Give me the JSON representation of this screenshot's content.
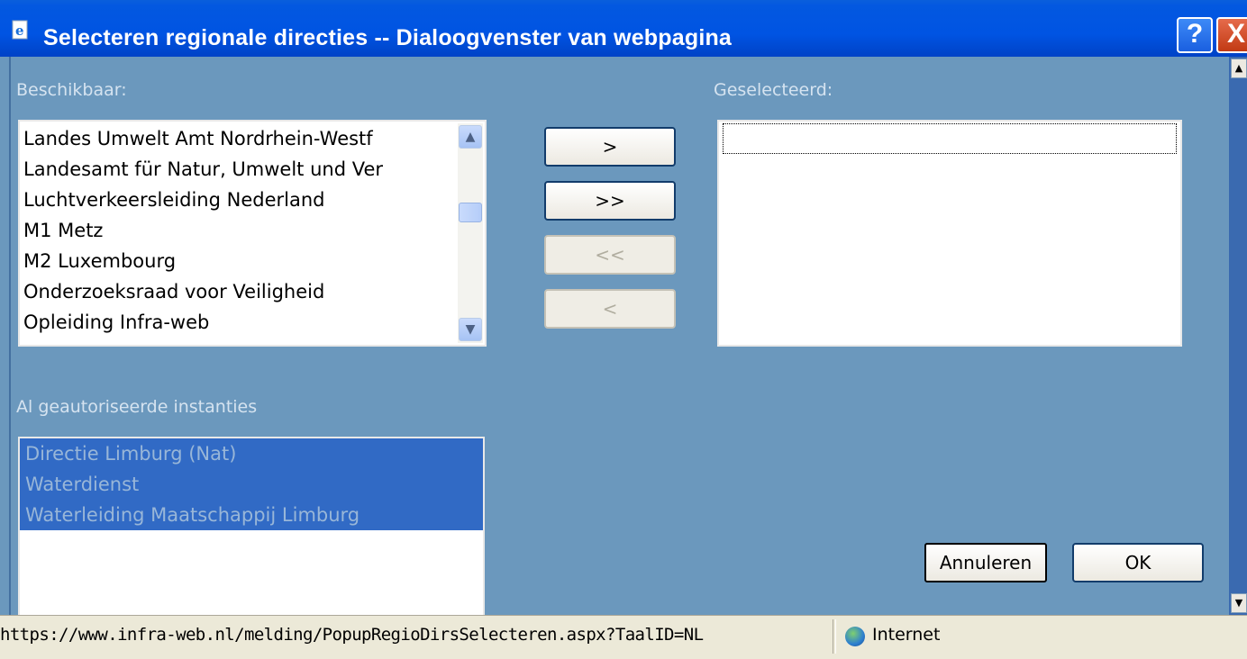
{
  "window": {
    "title": "Selecteren regionale directies -- Dialoogvenster van webpagina",
    "help_label": "?",
    "close_label": "X"
  },
  "available": {
    "label": "Beschikbaar:",
    "items": [
      "Landes Umwelt Amt Nordrhein-Westf",
      "Landesamt für Natur, Umwelt und Ver",
      "Luchtverkeersleiding Nederland",
      "M1 Metz",
      "M2 Luxembourg",
      "Onderzoeksraad voor Veiligheid",
      "Opleiding Infra-web"
    ]
  },
  "selected": {
    "label": "Geselecteerd:",
    "items": []
  },
  "transfer_buttons": {
    "add_one": ">",
    "add_all": ">>",
    "remove_all": "<<",
    "remove_one": "<"
  },
  "authorized": {
    "label": "Al geautoriseerde instanties",
    "items": [
      "Directie Limburg (Nat)",
      "Waterdienst",
      "Waterleiding Maatschappij Limburg"
    ]
  },
  "actions": {
    "cancel": "Annuleren",
    "ok": "OK"
  },
  "status": {
    "url": "https://www.infra-web.nl/melding/PopupRegioDirsSelecteren.aspx?TaalID=NL",
    "zone": "Internet"
  }
}
